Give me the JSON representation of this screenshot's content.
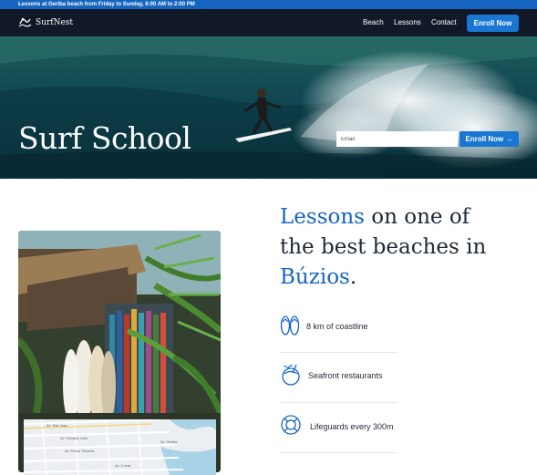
{
  "announcement": "Lessons at Geriba beach from Friday to Sunday, 6:00 AM to 2:00 PM",
  "brand": {
    "name": "SurfNest"
  },
  "nav": {
    "links": [
      "Beach",
      "Lessons",
      "Contact"
    ],
    "enroll_label": "Enroll Now"
  },
  "hero": {
    "title": "Surf School",
    "email_placeholder": "Email",
    "enroll_label": "Enroll Now →"
  },
  "headline": {
    "part1": "Lessons",
    "part2": " on one of the best beaches in ",
    "part3": "Búzios",
    "part4": "."
  },
  "features": [
    {
      "icon": "flip-flops-icon",
      "label": "8 km of coastline"
    },
    {
      "icon": "coconut-drink-icon",
      "label": "Seafront restaurants"
    },
    {
      "icon": "lifebuoy-icon",
      "label": "Lifeguards every 300m"
    }
  ],
  "map": {
    "street_labels": [
      "Av. Sao Joao",
      "Av. Geraldo Leite",
      "Av. Pedro Teixeira",
      "Av. Geriba",
      "Av. Costa"
    ]
  },
  "colors": {
    "accent": "#1565c0",
    "button": "#1976d2",
    "nav_bg": "#111827"
  }
}
